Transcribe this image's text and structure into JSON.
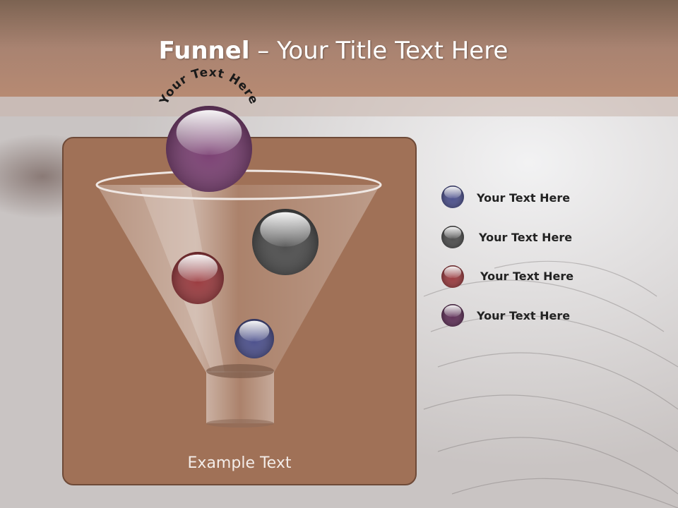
{
  "slide": {
    "title_bold": "Funnel",
    "title_rest": " – Your Title Text Here",
    "arc_text": "Your Text Here",
    "example_text": "Example Text"
  },
  "legend": [
    {
      "label": "Your  Text Here",
      "color": "#4b4f8c"
    },
    {
      "label": "Your  Text Here",
      "color": "#4d4d4d"
    },
    {
      "label": "Your  Text Here",
      "color": "#9a3a3e"
    },
    {
      "label": "Your  Text Here",
      "color": "#5e2f57"
    }
  ],
  "funnel_balls": [
    {
      "color": "#7a3f72"
    },
    {
      "color": "#4d4d4d"
    },
    {
      "color": "#9a3a3e"
    },
    {
      "color": "#4b4f8c"
    }
  ]
}
